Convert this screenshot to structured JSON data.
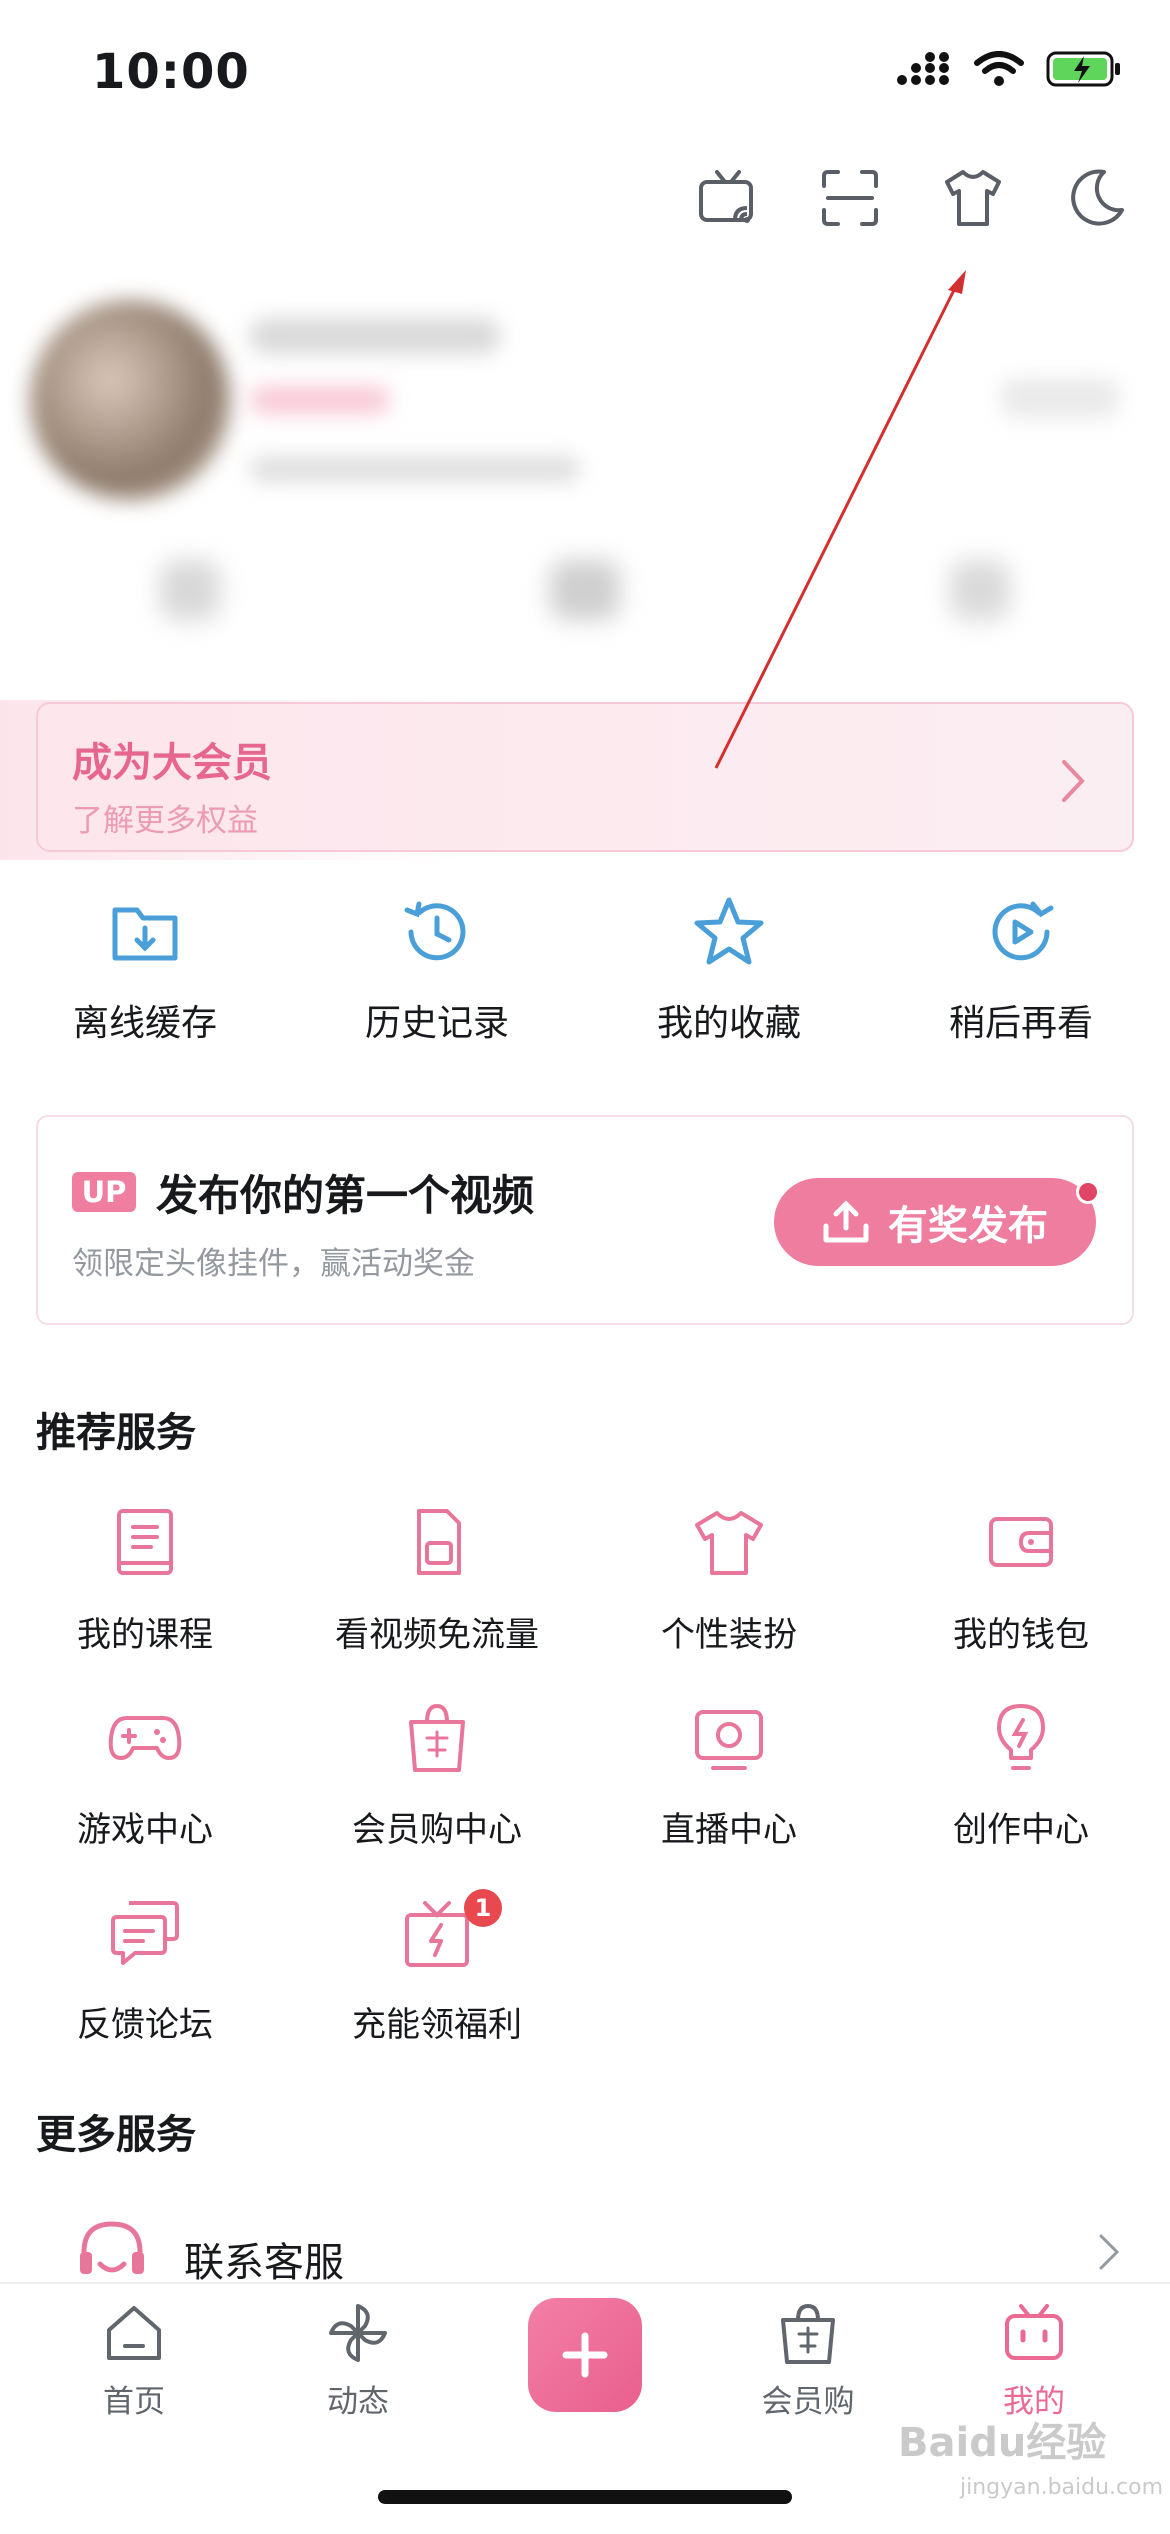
{
  "status_bar": {
    "time": "10:00"
  },
  "top_icons": [
    "tv-cast-icon",
    "scan-icon",
    "tshirt-icon",
    "moon-icon"
  ],
  "vip": {
    "title": "成为大会员",
    "subtitle": "了解更多权益"
  },
  "quick_actions": [
    {
      "label": "离线缓存",
      "icon": "download-folder-icon"
    },
    {
      "label": "历史记录",
      "icon": "history-clock-icon"
    },
    {
      "label": "我的收藏",
      "icon": "star-icon"
    },
    {
      "label": "稍后再看",
      "icon": "watch-later-icon"
    }
  ],
  "upload_card": {
    "badge": "UP",
    "title": "发布你的第一个视频",
    "subtitle": "领限定头像挂件，赢活动奖金",
    "button": "有奖发布"
  },
  "recommended": {
    "title": "推荐服务",
    "items": [
      {
        "label": "我的课程",
        "icon": "course-book-icon"
      },
      {
        "label": "看视频免流量",
        "icon": "sim-card-icon"
      },
      {
        "label": "个性装扮",
        "icon": "tshirt-icon"
      },
      {
        "label": "我的钱包",
        "icon": "wallet-icon"
      },
      {
        "label": "游戏中心",
        "icon": "gamepad-icon"
      },
      {
        "label": "会员购中心",
        "icon": "shopping-bag-icon"
      },
      {
        "label": "直播中心",
        "icon": "live-tv-icon"
      },
      {
        "label": "创作中心",
        "icon": "lightbulb-icon"
      },
      {
        "label": "反馈论坛",
        "icon": "chat-bubbles-icon"
      },
      {
        "label": "充能领福利",
        "icon": "gift-charge-icon",
        "badge": "1"
      }
    ]
  },
  "more_services": {
    "title": "更多服务",
    "items": [
      {
        "label": "联系客服",
        "icon": "headset-icon"
      }
    ]
  },
  "bottom_nav": [
    {
      "label": "首页",
      "icon": "home-icon"
    },
    {
      "label": "动态",
      "icon": "pinwheel-icon"
    },
    {
      "label": "",
      "icon": "plus-icon"
    },
    {
      "label": "会员购",
      "icon": "shopping-bag-icon"
    },
    {
      "label": "我的",
      "icon": "bilibili-tv-icon",
      "active": true
    }
  ],
  "watermark": {
    "text": "Baidu经验",
    "sub": "jingyan.baidu.com"
  },
  "colors": {
    "pink": "#ee7da0",
    "text": "#18191c",
    "grey": "#9499a0",
    "blue": "#4a9fd8",
    "annotation": "#d32f2f"
  }
}
